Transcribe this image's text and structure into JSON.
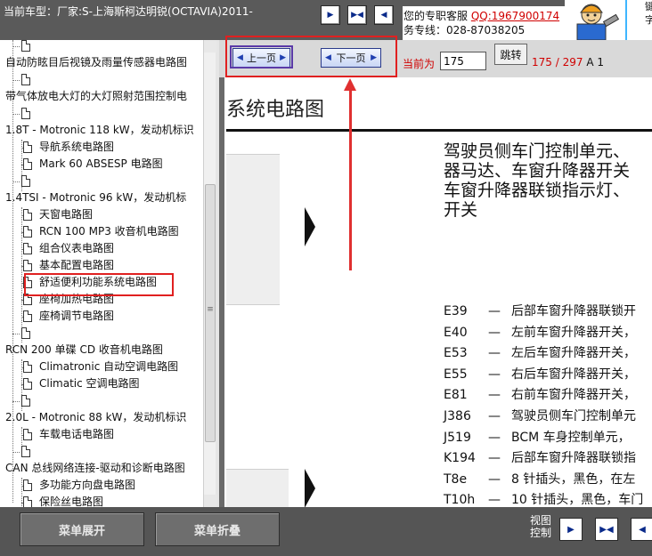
{
  "header": {
    "car_model_label": "当前车型：厂家:S-上海斯柯达明锐(OCTAVIA)2011-",
    "support_line1_prefix": "您的专职客服",
    "support_qq": "QQ:1967900174",
    "support_line2": "务专线：028-87038205",
    "right_panel_text": "键字"
  },
  "tree": {
    "items": [
      {
        "label": "",
        "type": "doc"
      },
      {
        "label": "自动防眩目后视镜及雨量传感器电路图",
        "type": "node"
      },
      {
        "label": "",
        "type": "doc"
      },
      {
        "label": "带气体放电大灯的大灯照射范围控制电",
        "type": "node"
      },
      {
        "label": "",
        "type": "doc"
      },
      {
        "label": "1.8T - Motronic 118 kW，发动机标识",
        "type": "node"
      },
      {
        "label": "导航系统电路图",
        "type": "doc"
      },
      {
        "label": "Mark 60 ABSESP 电路图",
        "type": "doc"
      },
      {
        "label": "",
        "type": "doc"
      },
      {
        "label": "1.4TSI - Motronic 96 kW，发动机标",
        "type": "node"
      },
      {
        "label": "天窗电路图",
        "type": "doc"
      },
      {
        "label": "RCN 100 MP3 收音机电路图",
        "type": "doc"
      },
      {
        "label": "组合仪表电路图",
        "type": "doc"
      },
      {
        "label": "基本配置电路图",
        "type": "doc"
      },
      {
        "label": "舒适便利功能系统电路图",
        "type": "doc"
      },
      {
        "label": "座椅加热电路图",
        "type": "doc"
      },
      {
        "label": "座椅调节电路图",
        "type": "doc"
      },
      {
        "label": "",
        "type": "doc"
      },
      {
        "label": "RCN 200 单碟 CD 收音机电路图",
        "type": "node"
      },
      {
        "label": "Climatronic 自动空调电路图",
        "type": "doc"
      },
      {
        "label": "Climatic 空调电路图",
        "type": "doc"
      },
      {
        "label": "",
        "type": "doc"
      },
      {
        "label": "2.0L - Motronic 88 kW，发动机标识",
        "type": "node"
      },
      {
        "label": "车载电话电路图",
        "type": "doc"
      },
      {
        "label": "",
        "type": "doc"
      },
      {
        "label": "CAN 总线网络连接-驱动和诊断电路图",
        "type": "node"
      },
      {
        "label": "多功能方向盘电路图",
        "type": "doc"
      },
      {
        "label": "保险丝电路图",
        "type": "doc"
      }
    ]
  },
  "nav": {
    "prev_label": "上一页",
    "next_label": "下一页",
    "current_label": "当前为",
    "page_value": "175",
    "jump_label": "跳转",
    "page_current_total": "175 / 297",
    "page_suffix": "A 1"
  },
  "document": {
    "title": "系统电路图",
    "heading_lines": [
      "驾驶员侧车门控制单元、",
      "器马达、车窗升降器开关",
      "车窗升降器联锁指示灯、",
      "开关"
    ],
    "legend": [
      {
        "code": "E39",
        "text": "后部车窗升降器联锁开"
      },
      {
        "code": "E40",
        "text": "左前车窗升降器开关，"
      },
      {
        "code": "E53",
        "text": "左后车窗升降器开关，"
      },
      {
        "code": "E55",
        "text": "右后车窗升降器开关，"
      },
      {
        "code": "E81",
        "text": "右前车窗升降器开关，"
      },
      {
        "code": "J386",
        "text": "驾驶员侧车门控制单元"
      },
      {
        "code": "J519",
        "text": "BCM 车身控制单元，"
      },
      {
        "code": "K194",
        "text": "后部车窗升降器联锁指"
      },
      {
        "code": "T8e",
        "text": "8 针插头，黑色，在左"
      },
      {
        "code": "T10h",
        "text": "10 针插头，黑色，车门"
      }
    ]
  },
  "footer": {
    "expand_label": "菜单展开",
    "collapse_label": "菜单折叠",
    "view_control_line1": "视图",
    "view_control_line2": "控制"
  },
  "colors": {
    "highlight_red": "#e02020",
    "status_red": "#d00000",
    "nav_button_blue": "#1f3fb0"
  }
}
